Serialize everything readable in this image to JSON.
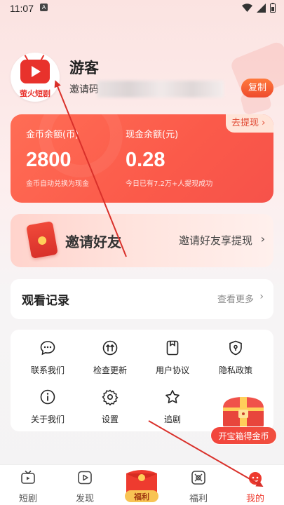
{
  "status": {
    "time": "11:07",
    "indicator": "A"
  },
  "profile": {
    "avatar_text": "萤火短剧",
    "nickname": "游客",
    "invite_label": "邀请码",
    "copy_button": "复制"
  },
  "wallet": {
    "withdraw_label": "去提现",
    "coin_label": "金币余额(币)",
    "coin_value": "2800",
    "coin_note": "金币自动兑换为现金",
    "cash_label": "现金余额(元)",
    "cash_value": "0.28",
    "cash_note": "今日已有7.2万+人提现成功"
  },
  "invite": {
    "title": "邀请好友",
    "subtitle": "邀请好友享提现"
  },
  "history": {
    "title": "观看记录",
    "more": "查看更多"
  },
  "menu": {
    "contact": "联系我们",
    "update": "检查更新",
    "agreement": "用户协议",
    "privacy": "隐私政策",
    "about": "关于我们",
    "settings": "设置",
    "follow": "追剧"
  },
  "treasure": {
    "label": "开宝箱得金币"
  },
  "tabbar": {
    "shorts": "短剧",
    "discover": "发现",
    "fuli_badge": "福利",
    "fuli": "福利",
    "mine": "我的"
  },
  "colors": {
    "accent": "#ee3b2f",
    "card_red": "#fb5a4a",
    "annotation": "#d9302a"
  },
  "icons": {
    "contact": "chat-icon",
    "update": "upload-circle-icon",
    "agreement": "document-icon",
    "privacy": "shield-icon",
    "about": "info-icon",
    "settings": "gear-icon",
    "follow": "star-icon"
  }
}
